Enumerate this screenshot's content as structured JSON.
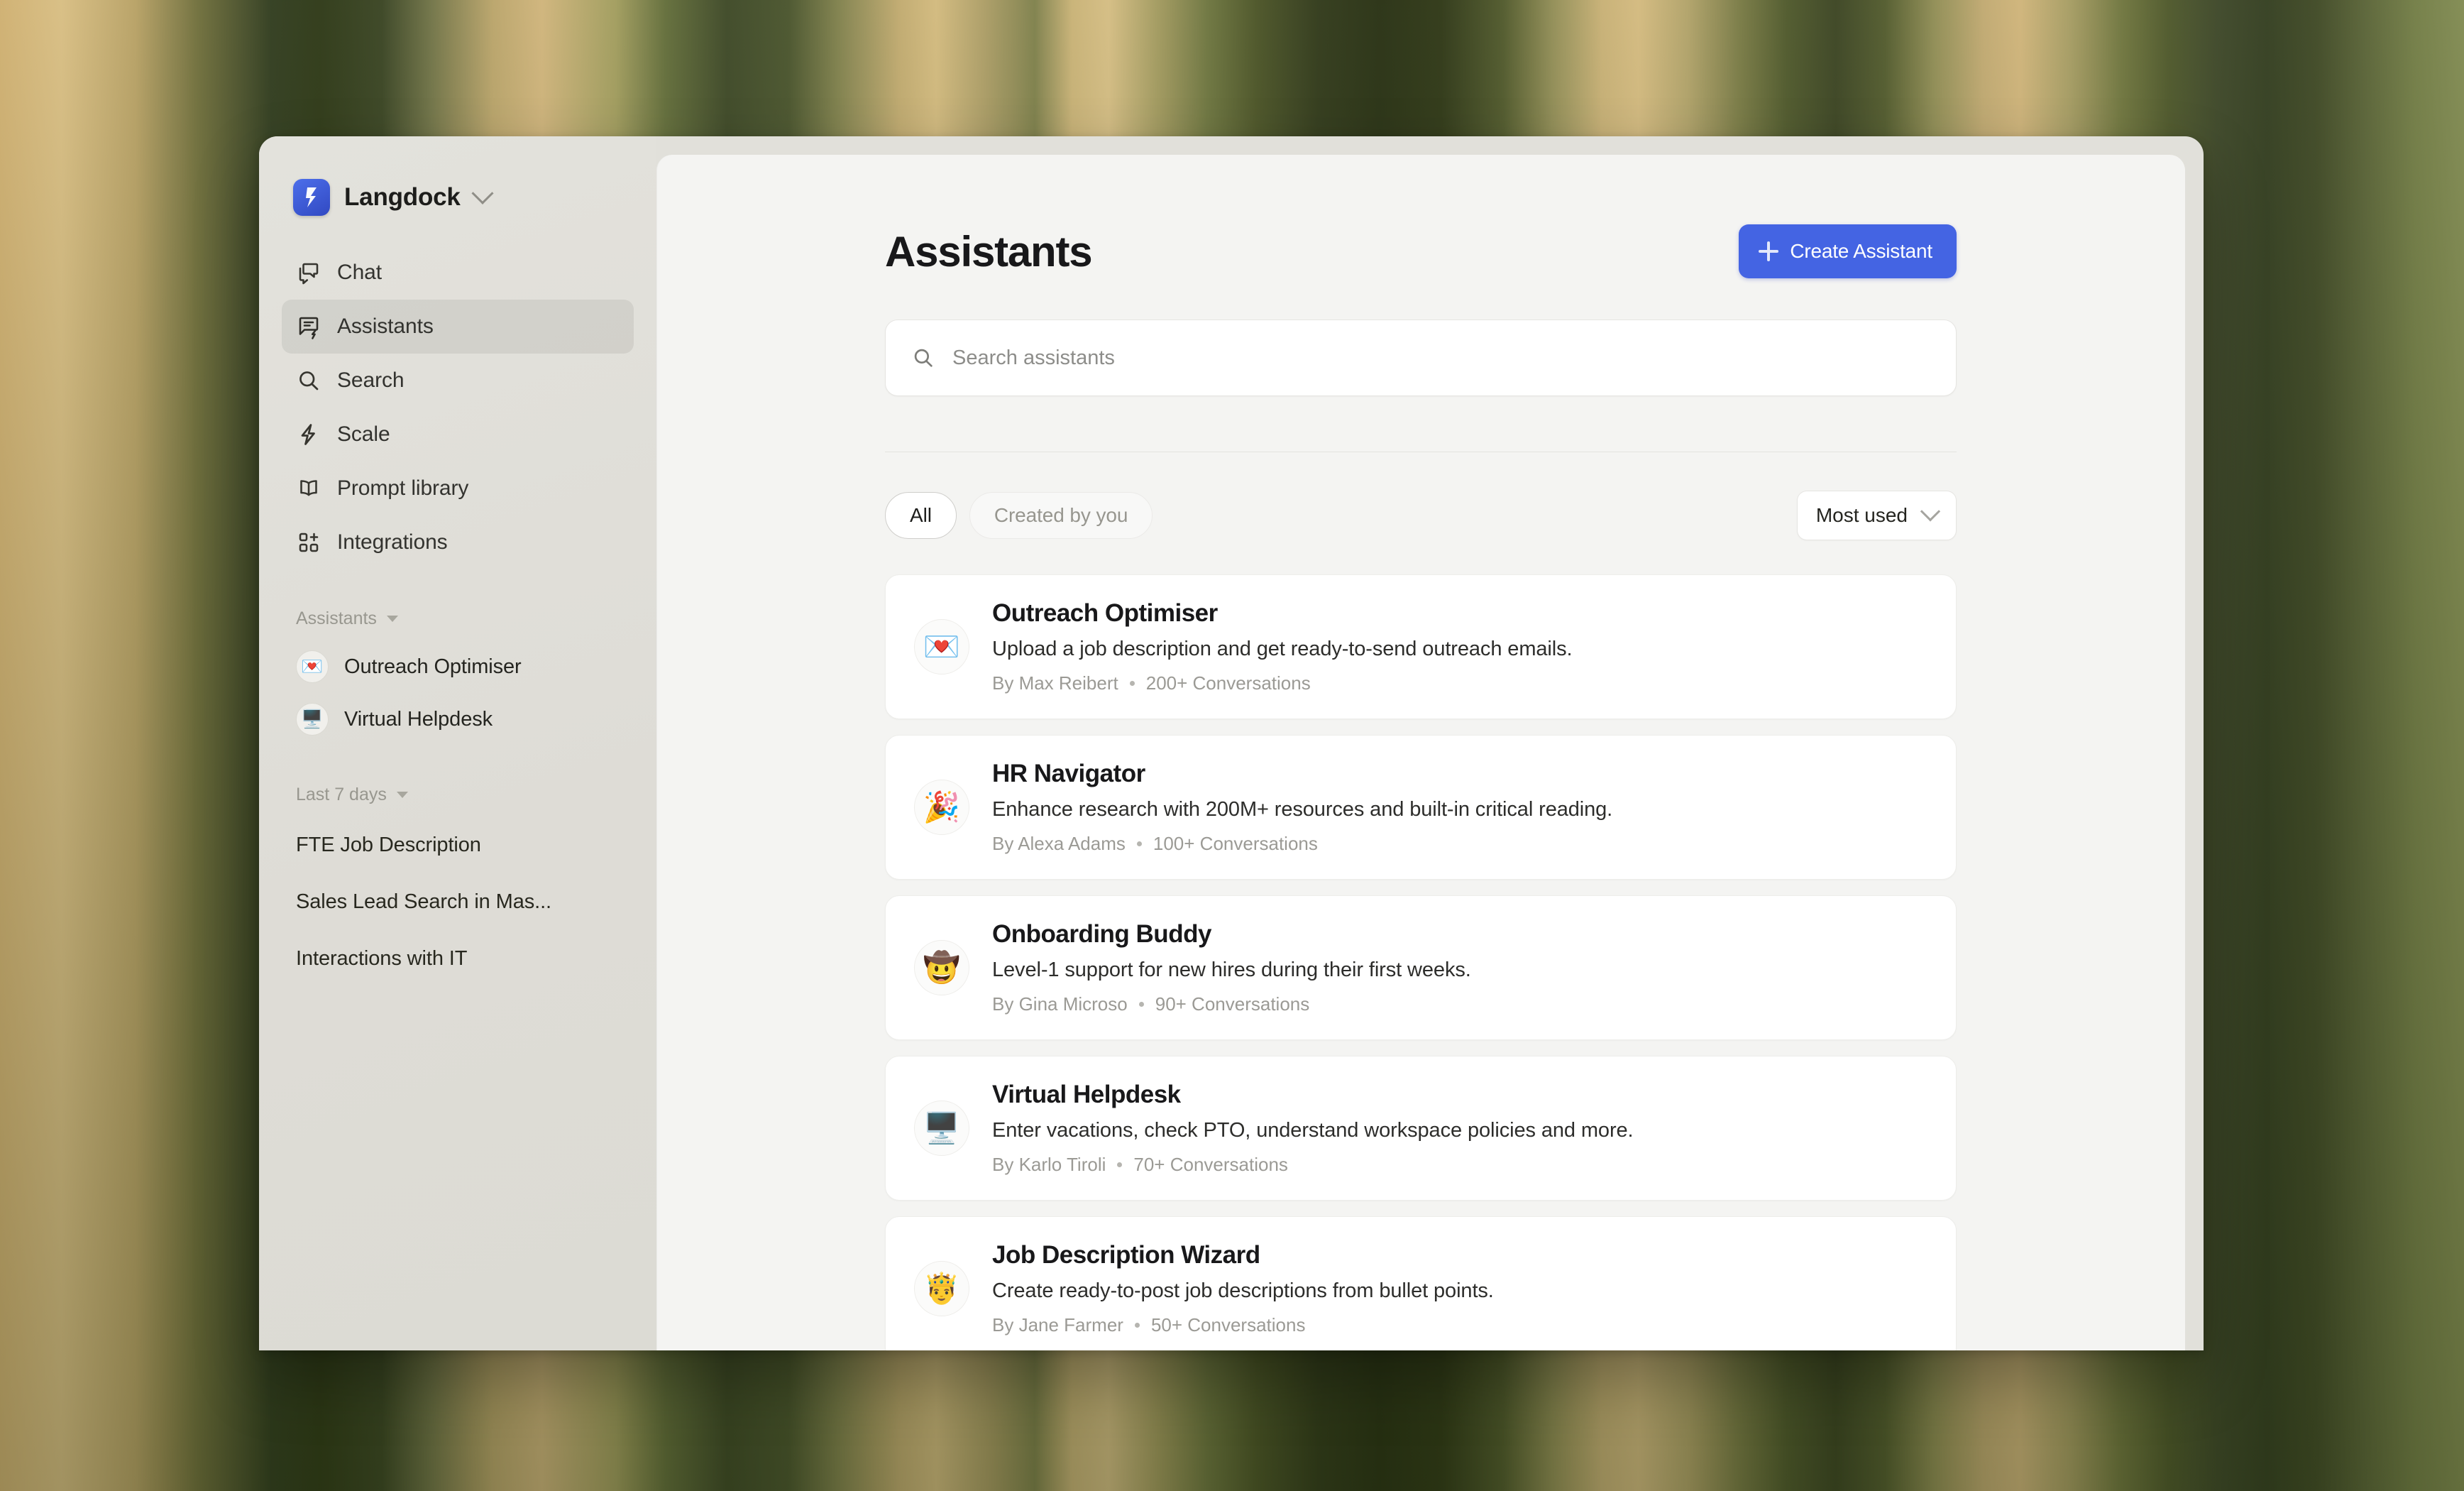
{
  "workspace": {
    "name": "Langdock",
    "logo_icon": "langdock-logo",
    "chevron_icon": "chevron-down-icon"
  },
  "sidebar": {
    "nav": [
      {
        "label": "Chat",
        "icon": "chat-bubbles-icon",
        "active": false
      },
      {
        "label": "Assistants",
        "icon": "assistant-chat-icon",
        "active": true
      },
      {
        "label": "Search",
        "icon": "search-icon",
        "active": false
      },
      {
        "label": "Scale",
        "icon": "lightning-bolt-icon",
        "active": false
      },
      {
        "label": "Prompt library",
        "icon": "book-open-icon",
        "active": false
      },
      {
        "label": "Integrations",
        "icon": "grid-plus-icon",
        "active": false
      }
    ],
    "assistants_group": {
      "label": "Assistants",
      "items": [
        {
          "label": "Outreach Optimiser",
          "emoji": "💌"
        },
        {
          "label": "Virtual Helpdesk",
          "emoji": "🖥️"
        }
      ]
    },
    "history_group": {
      "label": "Last 7 days",
      "items": [
        {
          "label": "FTE Job Description"
        },
        {
          "label": "Sales Lead Search in Mas..."
        },
        {
          "label": "Interactions with IT"
        }
      ]
    }
  },
  "main": {
    "title": "Assistants",
    "create_button": {
      "label": "Create Assistant",
      "icon": "plus-icon"
    },
    "search": {
      "placeholder": "Search assistants",
      "value": "",
      "icon": "search-icon"
    },
    "filters": [
      {
        "label": "All",
        "active": true
      },
      {
        "label": "Created by you",
        "active": false
      }
    ],
    "sort": {
      "value": "Most used",
      "icon": "chevron-down-icon"
    },
    "assistants": [
      {
        "emoji": "💌",
        "title": "Outreach Optimiser",
        "description": "Upload a job description and get ready-to-send outreach emails.",
        "author": "By Max Reibert",
        "conversations": "200+ Conversations"
      },
      {
        "emoji": "🎉",
        "title": "HR Navigator",
        "description": "Enhance research with 200M+ resources and built-in critical reading.",
        "author": "By Alexa Adams",
        "conversations": "100+ Conversations"
      },
      {
        "emoji": "🤠",
        "title": "Onboarding Buddy",
        "description": "Level-1 support for new hires during their first weeks.",
        "author": "By Gina Microso",
        "conversations": "90+ Conversations"
      },
      {
        "emoji": "🖥️",
        "title": "Virtual Helpdesk",
        "description": "Enter vacations, check PTO, understand workspace policies and more.",
        "author": "By Karlo Tiroli",
        "conversations": "70+ Conversations"
      },
      {
        "emoji": "🤴",
        "title": "Job Description Wizard",
        "description": "Create ready-to-post job descriptions from bullet points.",
        "author": "By Jane Farmer",
        "conversations": "50+ Conversations"
      }
    ]
  },
  "colors": {
    "accent": "#4264ea",
    "sidebar_bg": "#e1e0da",
    "main_bg": "#f4f4f2",
    "card_bg": "#ffffff"
  }
}
